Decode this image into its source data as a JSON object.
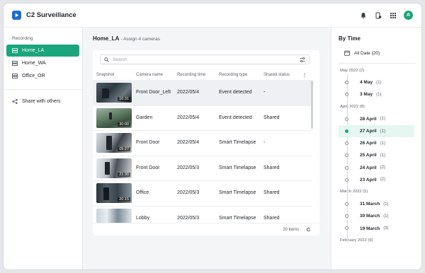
{
  "app": {
    "title": "C2 Surveillance",
    "avatar_letter": "A",
    "accent": "#1aa57d"
  },
  "sidebar": {
    "section_label": "Recording",
    "items": [
      {
        "label": "Home_LA",
        "active": true
      },
      {
        "label": "Home_WA",
        "active": false
      },
      {
        "label": "Office_OR",
        "active": false
      }
    ],
    "share_label": "Share with others"
  },
  "main": {
    "title": "Home_LA",
    "subtitle": "- Assign 4 cameras",
    "search_placeholder": "Search",
    "columns": [
      "Snapshot",
      "Camera name",
      "Recording time",
      "Recording type",
      "Shared status"
    ],
    "rows": [
      {
        "duration": "10:31",
        "camera": "Front Door_Left",
        "time": "2022/05/4",
        "type": "Event detected",
        "shared": "-"
      },
      {
        "duration": "30:00",
        "camera": "Garden",
        "time": "2022/05/4",
        "type": "Event detected",
        "shared": "Shared"
      },
      {
        "duration": "05:27",
        "camera": "Front Door",
        "time": "2022/05/4",
        "type": "Smart Timelapse",
        "shared": "-"
      },
      {
        "duration": "21:30",
        "camera": "Front Door",
        "time": "2022/05/3",
        "type": "Smart Timelapse",
        "shared": "Shared"
      },
      {
        "duration": "20:15",
        "camera": "Office",
        "time": "2022/05/3",
        "type": "Smart Timelapse",
        "shared": "Shared"
      },
      {
        "duration": "",
        "camera": "Lobby",
        "time": "2022/05/3",
        "type": "Smart Timelapse",
        "shared": "Shared"
      }
    ],
    "footer_count": "20 items"
  },
  "timeline": {
    "title": "By Time",
    "all_label": "All Date (20)",
    "months": [
      {
        "label": "May 2022 (2)",
        "days": [
          {
            "label": "4 May",
            "count": "(1)"
          },
          {
            "label": "3 May",
            "count": "(1)"
          }
        ]
      },
      {
        "label": "April 2022 (8)",
        "days": [
          {
            "label": "28 April",
            "count": "(1)"
          },
          {
            "label": "27 April",
            "count": "(1)",
            "active": true
          },
          {
            "label": "26 April",
            "count": "(1)"
          },
          {
            "label": "25 April",
            "count": "(1)"
          },
          {
            "label": "24 April",
            "count": "(2)"
          },
          {
            "label": "23 April",
            "count": "(2)"
          }
        ]
      },
      {
        "label": "March 2022 (5)",
        "days": [
          {
            "label": "31 March",
            "count": "(1)"
          },
          {
            "label": "30 March",
            "count": "(1)"
          },
          {
            "label": "19 March",
            "count": "(3)"
          }
        ]
      },
      {
        "label": "February 2022 (9)",
        "days": []
      }
    ]
  }
}
